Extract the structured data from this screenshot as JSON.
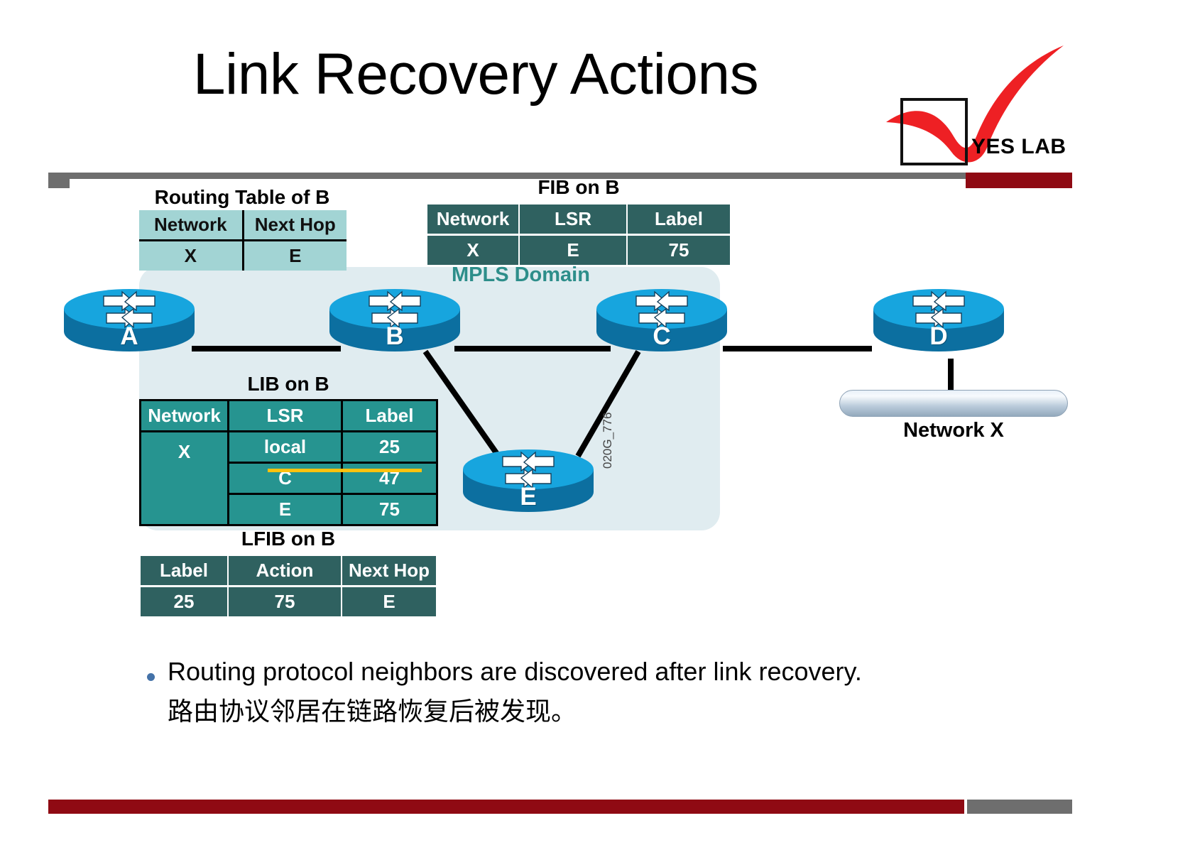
{
  "slide": {
    "title": "Link Recovery Actions",
    "logo": {
      "text": "YES LAB",
      "icon": "checkmark-icon",
      "accent_color": "#ee2024"
    },
    "diagram_ref": "020G_776",
    "mpls_label": "MPLS Domain",
    "mpls_color": "#2d8e8a",
    "network_label": "Network X"
  },
  "routers": [
    {
      "id": "A",
      "label": "A"
    },
    {
      "id": "B",
      "label": "B"
    },
    {
      "id": "C",
      "label": "C"
    },
    {
      "id": "D",
      "label": "D"
    },
    {
      "id": "E",
      "label": "E"
    }
  ],
  "tables": {
    "routing": {
      "caption": "Routing Table of B",
      "headers": [
        "Network",
        "Next Hop"
      ],
      "rows": [
        [
          "X",
          "E"
        ]
      ]
    },
    "fib": {
      "caption": "FIB on B",
      "headers": [
        "Network",
        "LSR",
        "Label"
      ],
      "rows": [
        [
          "X",
          "E",
          "75"
        ]
      ]
    },
    "lib": {
      "caption": "LIB on B",
      "headers": [
        "Network",
        "LSR",
        "Label"
      ],
      "rows": [
        [
          "X",
          "local",
          "25"
        ],
        [
          "",
          "C",
          "47"
        ],
        [
          "",
          "E",
          "75"
        ]
      ],
      "struck_row_index": 1,
      "strike_color": "#ffc20e"
    },
    "lfib": {
      "caption": "LFIB on B",
      "headers": [
        "Label",
        "Action",
        "Next Hop"
      ],
      "rows": [
        [
          "25",
          "75",
          "E"
        ]
      ]
    }
  },
  "bullets": {
    "en": "Routing protocol neighbors are discovered after link recovery.",
    "zh": "路由协议邻居在链路恢复后被发现。"
  },
  "colors": {
    "routing_table_bg": "#a2d4d4",
    "fib_bg": "#2f6160",
    "lib_bg": "#269490",
    "mpls_region_bg": "#e0ecf0",
    "router_top": "#17a5de",
    "router_body": "#0c6fa0",
    "footer_red": "#8f0a13",
    "footer_grey": "#6e6e6e"
  }
}
